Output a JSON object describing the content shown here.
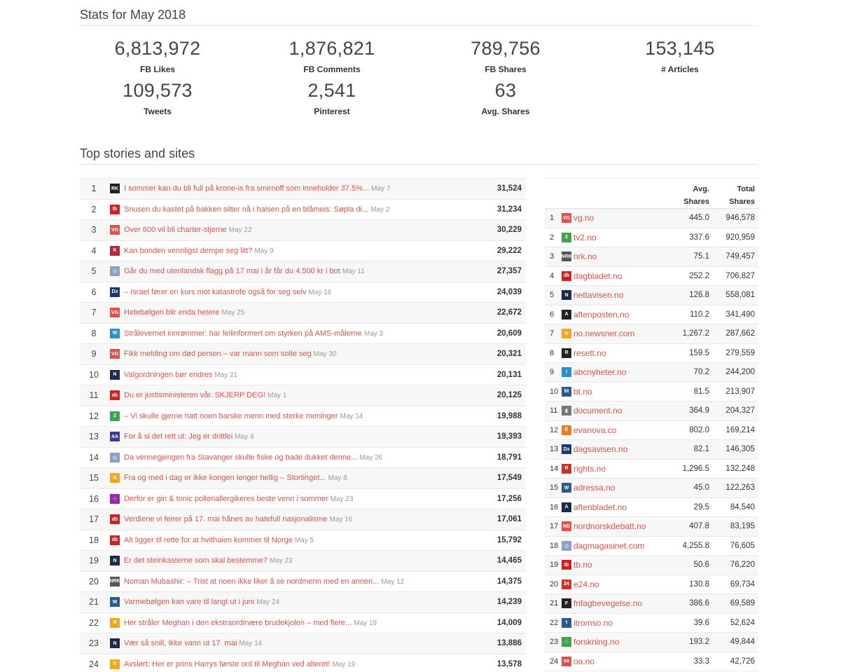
{
  "stats_title": "Stats for May 2018",
  "stats": [
    {
      "value": "6,813,972",
      "label": "FB Likes"
    },
    {
      "value": "1,876,821",
      "label": "FB Comments"
    },
    {
      "value": "789,756",
      "label": "FB Shares"
    },
    {
      "value": "153,145",
      "label": "# Articles"
    },
    {
      "value": "109,573",
      "label": "Tweets"
    },
    {
      "value": "2,541",
      "label": "Pinterest"
    },
    {
      "value": "63",
      "label": "Avg. Shares"
    }
  ],
  "top_title": "Top stories and sites",
  "stories": [
    {
      "rank": "1",
      "icon": "rk-icon",
      "color": "#222222",
      "glyph": "RK",
      "title": "I sommer kan du bli full på krone-is fra smirnoff som inneholder 37.5%...",
      "date": "May 7",
      "shares": "31,524"
    },
    {
      "rank": "2",
      "icon": "tb-icon",
      "color": "#cc2222",
      "glyph": "tb",
      "title": "Snusen du kastet på bakken sitter nå i halsen på en blåmeis: Søpla di...",
      "date": "May 2",
      "shares": "31,234"
    },
    {
      "rank": "3",
      "icon": "vg-icon",
      "color": "#d9534f",
      "glyph": "VG",
      "title": "Over 600 vil bli charter-stjerne",
      "date": "May 22",
      "shares": "30,229"
    },
    {
      "rank": "4",
      "icon": "k-icon",
      "color": "#b02a37",
      "glyph": "K",
      "title": "Kan bonden vennligst dempe seg litt?",
      "date": "May 9",
      "shares": "29,222"
    },
    {
      "rank": "5",
      "icon": "globe-icon",
      "color": "#8aa0c8",
      "glyph": "◎",
      "title": "Går du med utenlandsk flagg på 17 mai i år får du 4.500 kr i bot",
      "date": "May 11",
      "shares": "27,357"
    },
    {
      "rank": "6",
      "icon": "dagsavisen-icon",
      "color": "#1f3b6e",
      "glyph": "Dx",
      "title": "– Israel fører en kurs mot katastrofe også for seg selv",
      "date": "May 16",
      "shares": "24,039"
    },
    {
      "rank": "7",
      "icon": "vg-icon",
      "color": "#d9534f",
      "glyph": "VG",
      "title": "Hetebølgen blir enda hetere",
      "date": "May 25",
      "shares": "22,672"
    },
    {
      "rank": "8",
      "icon": "wordpress-icon",
      "color": "#2b8fc8",
      "glyph": "W",
      "title": "Strålevernet innrømmer: har feilinformert om styrken på AMS-målerne",
      "date": "May 3",
      "shares": "20,609"
    },
    {
      "rank": "9",
      "icon": "vg-icon",
      "color": "#d9534f",
      "glyph": "VG",
      "title": "Fikk melding om død person – var mann som solte seg",
      "date": "May 30",
      "shares": "20,321"
    },
    {
      "rank": "10",
      "icon": "nettavisen-icon",
      "color": "#1d2a4d",
      "glyph": "N",
      "title": "Valgordningen bør endres",
      "date": "May 21",
      "shares": "20,131"
    },
    {
      "rank": "11",
      "icon": "dagbladet-icon",
      "color": "#cc2222",
      "glyph": "db",
      "title": "Du er justisministeren vår. SKJERP DEG!",
      "date": "May 1",
      "shares": "20,125"
    },
    {
      "rank": "12",
      "icon": "tv2-icon",
      "color": "#3fa34d",
      "glyph": "2",
      "title": "– Vi skulle gjerne hatt noen barske menn med sterke meninger",
      "date": "May 14",
      "shares": "19,988"
    },
    {
      "rank": "13",
      "icon": "aa-icon",
      "color": "#3b3b8f",
      "glyph": "AA",
      "title": "For å si det rett ut: Jeg er drittlei",
      "date": "May 4",
      "shares": "19,393"
    },
    {
      "rank": "14",
      "icon": "globe-icon",
      "color": "#8aa0c8",
      "glyph": "◎",
      "title": "Da vennegjengen fra Stavanger skulle fiske og bade dukket denne...",
      "date": "May 26",
      "shares": "18,791"
    },
    {
      "rank": "15",
      "icon": "newsner-icon",
      "color": "#f0a71c",
      "glyph": "N",
      "title": "Fra og med i dag er ikke kongen lenger hellig – Stortinget...",
      "date": "May 8",
      "shares": "17,549"
    },
    {
      "rank": "16",
      "icon": "dots-icon",
      "color": "#9c27b0",
      "glyph": "⁘",
      "title": "Derfor er gin & tonic pollenallergikeres beste venn i sommer",
      "date": "May 23",
      "shares": "17,256"
    },
    {
      "rank": "17",
      "icon": "dagbladet-icon",
      "color": "#cc2222",
      "glyph": "db",
      "title": "Verdiene vi feirer på 17. mai hånes av hatefull nasjonalisme",
      "date": "May 16",
      "shares": "17,061"
    },
    {
      "rank": "18",
      "icon": "dagbladet-icon",
      "color": "#cc2222",
      "glyph": "db",
      "title": "Alt ligger til rette for at hvithaien kommer til Norge",
      "date": "May 5",
      "shares": "15,792"
    },
    {
      "rank": "19",
      "icon": "nettavisen-icon",
      "color": "#1d2a4d",
      "glyph": "N",
      "title": "Er det steinkasterne som skal bestemme?",
      "date": "May 23",
      "shares": "14,465"
    },
    {
      "rank": "20",
      "icon": "nrk-icon",
      "color": "#555555",
      "glyph": "NRK",
      "title": "Noman Mubashir: – Trist at noen ikke liker å se nordmenn med en annen...",
      "date": "May 12",
      "shares": "14,375"
    },
    {
      "rank": "21",
      "icon": "bt-icon",
      "color": "#2a5b8f",
      "glyph": "W",
      "title": "Varmebølgen kan vare til langt ut i juni",
      "date": "May 24",
      "shares": "14,239"
    },
    {
      "rank": "22",
      "icon": "newsner-icon",
      "color": "#f0a71c",
      "glyph": "N",
      "title": "Her stråler Meghan i den ekstraordinære brudekjolen – med flere...",
      "date": "May 19",
      "shares": "14,009"
    },
    {
      "rank": "23",
      "icon": "nettavisen-icon",
      "color": "#1d2a4d",
      "glyph": "N",
      "title": "Vær så snill, ikke vann ut 17. mai",
      "date": "May 14",
      "shares": "13,886"
    },
    {
      "rank": "24",
      "icon": "newsner-icon",
      "color": "#f0a71c",
      "glyph": "N",
      "title": "Avslørt: Her er prins Harrys første ord til Meghan ved alteret!",
      "date": "May 19",
      "shares": "13,578"
    }
  ],
  "sites_header": {
    "avg": "Avg. Shares",
    "avg_line1": "Avg.",
    "avg_line2": "Shares",
    "total_line1": "Total",
    "total_line2": "Shares"
  },
  "sites": [
    {
      "rank": "1",
      "icon": "vg-icon",
      "color": "#d9534f",
      "glyph": "VG",
      "name": "vg.no",
      "avg": "445.0",
      "total": "946,578"
    },
    {
      "rank": "2",
      "icon": "tv2-icon",
      "color": "#3fa34d",
      "glyph": "2",
      "name": "tv2.no",
      "avg": "337.6",
      "total": "920,959"
    },
    {
      "rank": "3",
      "icon": "nrk-icon",
      "color": "#555555",
      "glyph": "NRK",
      "name": "nrk.no",
      "avg": "75.1",
      "total": "749,457"
    },
    {
      "rank": "4",
      "icon": "dagbladet-icon",
      "color": "#cc2222",
      "glyph": "db",
      "name": "dagbladet.no",
      "avg": "252.2",
      "total": "706,827"
    },
    {
      "rank": "5",
      "icon": "nettavisen-icon",
      "color": "#1d2a4d",
      "glyph": "N",
      "name": "nettavisen.no",
      "avg": "126.8",
      "total": "558,081"
    },
    {
      "rank": "6",
      "icon": "aftenposten-icon",
      "color": "#222222",
      "glyph": "A",
      "name": "aftenposten.no",
      "avg": "110.2",
      "total": "341,490"
    },
    {
      "rank": "7",
      "icon": "newsner-icon",
      "color": "#f0a71c",
      "glyph": "N",
      "name": "no.newsner.com",
      "avg": "1,267.2",
      "total": "287,662"
    },
    {
      "rank": "8",
      "icon": "resett-icon",
      "color": "#222222",
      "glyph": "R",
      "name": "resett.no",
      "avg": "159.5",
      "total": "279,559"
    },
    {
      "rank": "9",
      "icon": "abc-icon",
      "color": "#2b8fc8",
      "glyph": "/",
      "name": "abcnyheter.no",
      "avg": "70.2",
      "total": "244,200"
    },
    {
      "rank": "10",
      "icon": "bt-icon",
      "color": "#2a5b8f",
      "glyph": "bt",
      "name": "bt.no",
      "avg": "81.5",
      "total": "213,907"
    },
    {
      "rank": "11",
      "icon": "document-icon",
      "color": "#777777",
      "glyph": "▮",
      "name": "document.no",
      "avg": "364.9",
      "total": "204,327"
    },
    {
      "rank": "12",
      "icon": "evanova-icon",
      "color": "#e67e22",
      "glyph": "E",
      "name": "evanova.co",
      "avg": "802.0",
      "total": "169,214"
    },
    {
      "rank": "13",
      "icon": "dagsavisen-icon",
      "color": "#1f3b6e",
      "glyph": "Dx",
      "name": "dagsavisen.no",
      "avg": "82.1",
      "total": "146,305"
    },
    {
      "rank": "14",
      "icon": "rights-icon",
      "color": "#c0392b",
      "glyph": "R",
      "name": "rights.no",
      "avg": "1,296.5",
      "total": "132,248"
    },
    {
      "rank": "15",
      "icon": "adressa-icon",
      "color": "#2a5b8f",
      "glyph": "W",
      "name": "adressa.no",
      "avg": "45.0",
      "total": "122,263"
    },
    {
      "rank": "16",
      "icon": "aftenbladet-icon",
      "color": "#1d2a4d",
      "glyph": "A",
      "name": "aftenbladet.no",
      "avg": "29.5",
      "total": "84,540"
    },
    {
      "rank": "17",
      "icon": "nordnorsk-icon",
      "color": "#d9534f",
      "glyph": "ND",
      "name": "nordnorskdebatt.no",
      "avg": "407.8",
      "total": "83,195"
    },
    {
      "rank": "18",
      "icon": "globe-icon",
      "color": "#8aa0c8",
      "glyph": "◎",
      "name": "dagmagasinet.com",
      "avg": "4,255.8",
      "total": "76,605"
    },
    {
      "rank": "19",
      "icon": "tb-icon",
      "color": "#cc2222",
      "glyph": "tb",
      "name": "tb.no",
      "avg": "50.6",
      "total": "76,220"
    },
    {
      "rank": "20",
      "icon": "e24-icon",
      "color": "#c0392b",
      "glyph": "24",
      "name": "e24.no",
      "avg": "130.8",
      "total": "69,734"
    },
    {
      "rank": "21",
      "icon": "frifag-icon",
      "color": "#222222",
      "glyph": "F",
      "name": "frifagbevegelse.no",
      "avg": "386.6",
      "total": "69,589"
    },
    {
      "rank": "22",
      "icon": "itromso-icon",
      "color": "#2a5b8f",
      "glyph": "t",
      "name": "itromso.no",
      "avg": "39.6",
      "total": "52,624"
    },
    {
      "rank": "23",
      "icon": "forskning-icon",
      "color": "#3fa34d",
      "glyph": "⁘",
      "name": "forskning.no",
      "avg": "193.2",
      "total": "49,844"
    },
    {
      "rank": "24",
      "icon": "oa-icon",
      "color": "#d9534f",
      "glyph": "oa",
      "name": "oa.no",
      "avg": "33.3",
      "total": "42,726"
    }
  ]
}
